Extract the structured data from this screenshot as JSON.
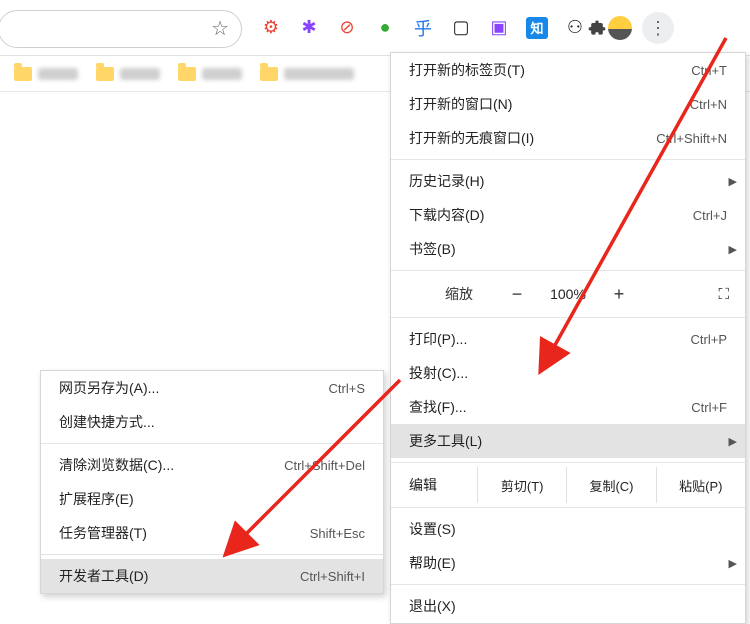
{
  "toolbar": {
    "star_icon": "☆",
    "extensions": [
      {
        "name": "ext-1",
        "glyph": "⚙",
        "cls": "c-red"
      },
      {
        "name": "ext-2",
        "glyph": "✱",
        "cls": "c-pur"
      },
      {
        "name": "ext-3",
        "glyph": "⊘",
        "cls": "c-red"
      },
      {
        "name": "ext-4",
        "glyph": "●",
        "cls": "c-grn"
      },
      {
        "name": "ext-5",
        "glyph": "乎",
        "cls": "c-blu"
      },
      {
        "name": "ext-6",
        "glyph": "▢",
        "cls": ""
      },
      {
        "name": "ext-7",
        "glyph": "▣",
        "cls": "c-pur"
      },
      {
        "name": "ext-8",
        "glyph": "知",
        "cls": "sq-zhi"
      },
      {
        "name": "ext-9",
        "glyph": "⚇",
        "cls": ""
      }
    ],
    "puzzle": "✦",
    "kebab": "⋮"
  },
  "menu": {
    "new_tab": {
      "label": "打开新的标签页(T)",
      "shortcut": "Ctrl+T"
    },
    "new_window": {
      "label": "打开新的窗口(N)",
      "shortcut": "Ctrl+N"
    },
    "new_incognito": {
      "label": "打开新的无痕窗口(I)",
      "shortcut": "Ctrl+Shift+N"
    },
    "history": {
      "label": "历史记录(H)"
    },
    "downloads": {
      "label": "下载内容(D)",
      "shortcut": "Ctrl+J"
    },
    "bookmarks": {
      "label": "书签(B)"
    },
    "zoom": {
      "label": "缩放",
      "minus": "−",
      "pct": "100%",
      "plus": "+",
      "fullscreen": "⛶"
    },
    "print": {
      "label": "打印(P)...",
      "shortcut": "Ctrl+P"
    },
    "cast": {
      "label": "投射(C)..."
    },
    "find": {
      "label": "查找(F)...",
      "shortcut": "Ctrl+F"
    },
    "more_tools": {
      "label": "更多工具(L)"
    },
    "edit": {
      "label": "编辑",
      "cut": "剪切(T)",
      "copy": "复制(C)",
      "paste": "粘贴(P)"
    },
    "settings": {
      "label": "设置(S)"
    },
    "help": {
      "label": "帮助(E)"
    },
    "exit": {
      "label": "退出(X)"
    }
  },
  "submenu": {
    "save_as": {
      "label": "网页另存为(A)...",
      "shortcut": "Ctrl+S"
    },
    "create_shortcut": {
      "label": "创建快捷方式..."
    },
    "clear_data": {
      "label": "清除浏览数据(C)...",
      "shortcut": "Ctrl+Shift+Del"
    },
    "extensions": {
      "label": "扩展程序(E)"
    },
    "task_manager": {
      "label": "任务管理器(T)",
      "shortcut": "Shift+Esc"
    },
    "devtools": {
      "label": "开发者工具(D)",
      "shortcut": "Ctrl+Shift+I"
    }
  }
}
